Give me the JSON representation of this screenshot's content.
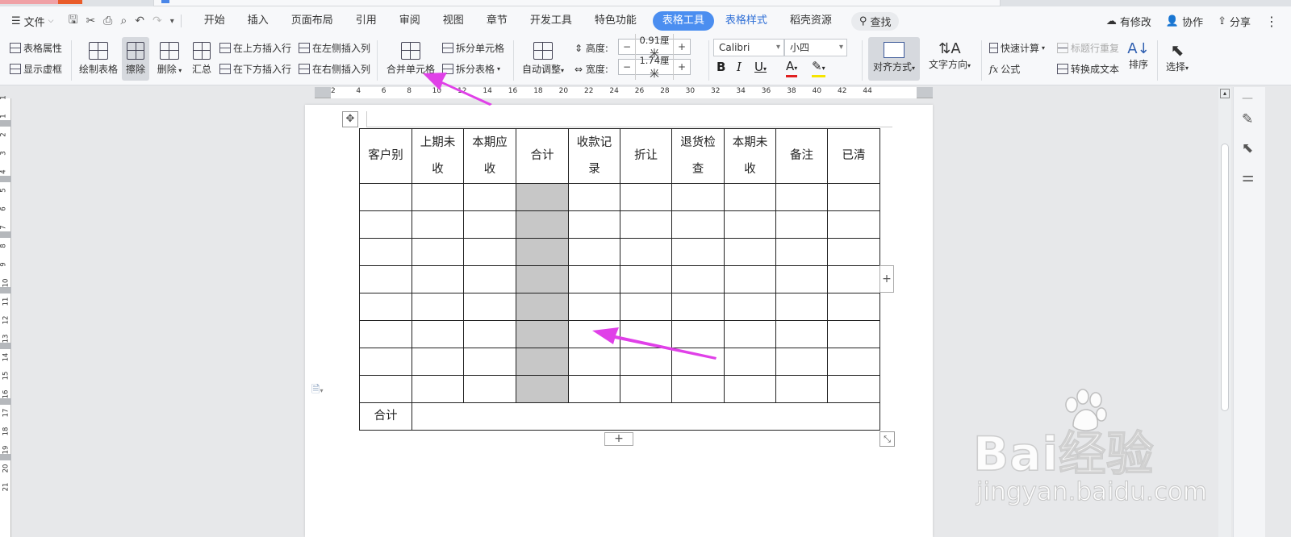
{
  "menubar": {
    "file_label": "文件",
    "tabs": [
      "开始",
      "插入",
      "页面布局",
      "引用",
      "审阅",
      "视图",
      "章节",
      "开发工具",
      "特色功能"
    ],
    "active_tab": "表格工具",
    "tab_table_style": "表格样式",
    "tab_resources": "稻壳资源",
    "search_label": "查找",
    "right": {
      "modified": "有修改",
      "collab": "协作",
      "share": "分享"
    }
  },
  "ribbon": {
    "table_props": "表格属性",
    "show_grid": "显示虚框",
    "draw_table": "绘制表格",
    "erase": "擦除",
    "delete": "删除",
    "summary": "汇总",
    "insert_above": "在上方插入行",
    "insert_below": "在下方插入行",
    "insert_left": "在左侧插入列",
    "insert_right": "在右侧插入列",
    "merge_cells": "合并单元格",
    "split_cells": "拆分单元格",
    "split_table": "拆分表格",
    "auto_adjust": "自动调整",
    "height_label": "高度:",
    "height_value": "0.91厘米",
    "width_label": "宽度:",
    "width_value": "1.74厘米",
    "font_name": "Calibri",
    "font_size": "小四",
    "align": "对齐方式",
    "text_dir": "文字方向",
    "quick_calc": "快速计算",
    "repeat_title": "标题行重复",
    "formula": "公式",
    "to_text": "转换成文本",
    "sort": "排序",
    "select": "选择"
  },
  "ruler": {
    "h_ticks": [
      "2",
      "4",
      "6",
      "8",
      "10",
      "12",
      "14",
      "16",
      "18",
      "20",
      "22",
      "24",
      "26",
      "28",
      "30",
      "32",
      "34",
      "36",
      "38",
      "40",
      "42",
      "44"
    ],
    "v_ticks": [
      "1",
      "1",
      "2",
      "3",
      "4",
      "5",
      "6",
      "7",
      "8",
      "9",
      "10",
      "11",
      "12",
      "13",
      "14",
      "15",
      "16",
      "17",
      "18",
      "19",
      "20",
      "21"
    ]
  },
  "table": {
    "headers": [
      [
        "客户别"
      ],
      [
        "上期未",
        "收"
      ],
      [
        "本期应",
        "收"
      ],
      [
        "合计"
      ],
      [
        "收款记",
        "录"
      ],
      [
        "折让"
      ],
      [
        "退货检",
        "查"
      ],
      [
        "本期未",
        "收"
      ],
      [
        "备注"
      ],
      [
        "已清"
      ]
    ],
    "body_rows": 8,
    "selected_column": 3,
    "footer_label": "合计"
  },
  "watermark": {
    "brand": "Bai经验",
    "url": "jingyan.baidu.com"
  },
  "colors": {
    "accent": "#4b8ef0",
    "arrow": "#e040e8",
    "selection": "#c7c7c7"
  }
}
